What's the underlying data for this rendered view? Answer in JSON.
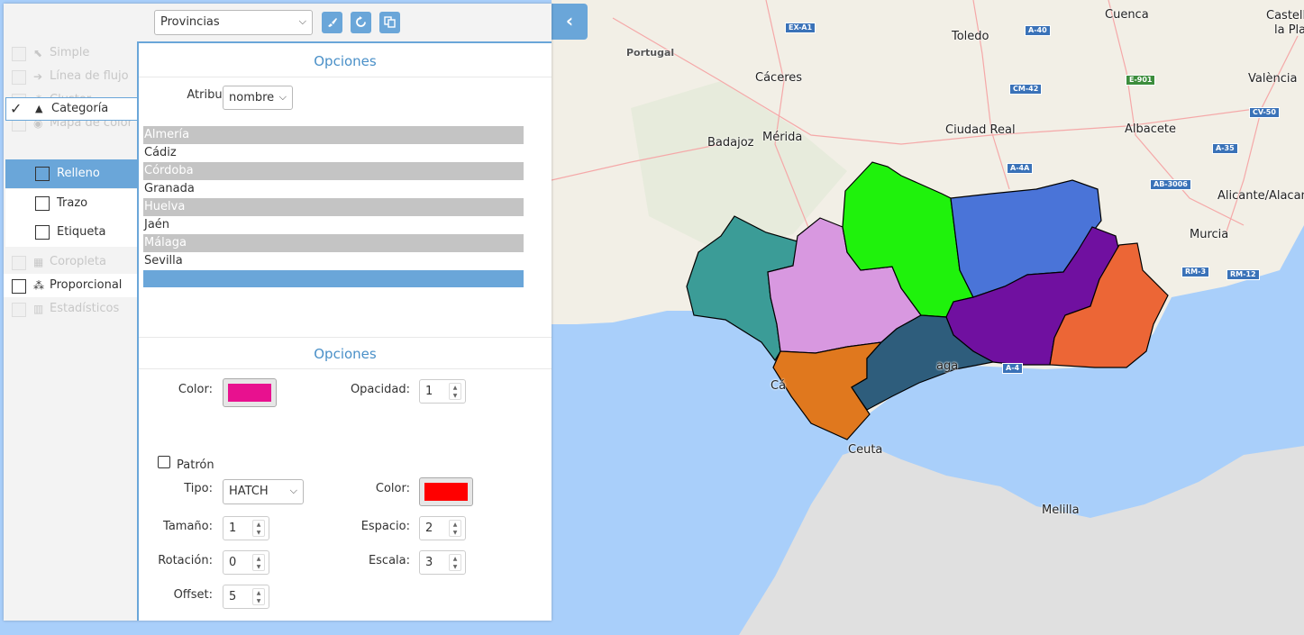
{
  "toolbar": {
    "layer_select": "Provincias",
    "brush_icon": "brush-icon",
    "refresh_icon": "refresh-icon",
    "copy_icon": "copy-icon",
    "collapse_icon": "chevron-left-icon"
  },
  "sidebar": {
    "items": [
      {
        "label": "Simple",
        "icon": "cursor-icon",
        "enabled": false
      },
      {
        "label": "Línea de flujo",
        "icon": "arrow-right-icon",
        "enabled": false
      },
      {
        "label": "Cluster",
        "icon": "cluster-icon",
        "enabled": false
      },
      {
        "label": "Mapa de color",
        "icon": "heatmap-icon",
        "enabled": false
      },
      {
        "label": "Categoría",
        "icon": "category-icon",
        "enabled": true,
        "checked": true
      },
      {
        "label": "Coropleta",
        "icon": "choropleth-icon",
        "enabled": false
      },
      {
        "label": "Proporcional",
        "icon": "proportional-icon",
        "enabled": true
      },
      {
        "label": "Estadísticos",
        "icon": "bar-chart-icon",
        "enabled": false
      }
    ],
    "subitems": [
      {
        "label": "Relleno",
        "active": true
      },
      {
        "label": "Trazo",
        "active": false
      },
      {
        "label": "Etiqueta",
        "active": false
      }
    ]
  },
  "options1": {
    "title": "Opciones",
    "attribute_label": "Atributo:",
    "attribute_value": "nombre",
    "categories": [
      "Almería",
      "Cádiz",
      "Córdoba",
      "Granada",
      "Huelva",
      "Jaén",
      "Málaga",
      "Sevilla",
      ""
    ]
  },
  "options2": {
    "title": "Opciones",
    "color_label": "Color:",
    "color_value": "#e8118f",
    "opacity_label": "Opacidad:",
    "opacity_value": "1",
    "pattern_label": "Patrón",
    "type_label": "Tipo:",
    "type_value": "HATCH",
    "pattern_color_label": "Color:",
    "pattern_color_value": "#ff0000",
    "size_label": "Tamaño:",
    "size_value": "1",
    "space_label": "Espacio:",
    "space_value": "2",
    "rotation_label": "Rotación:",
    "rotation_value": "0",
    "scale_label": "Escala:",
    "scale_value": "3",
    "offset_label": "Offset:",
    "offset_value": "5"
  },
  "map": {
    "cities": [
      "Cuenca",
      "Castell",
      "la Pla",
      "Toledo",
      "Portugal",
      "Cáceres",
      "València",
      "Badajoz",
      "Mérida",
      "Ciudad Real",
      "Albacete",
      "Alicante/Alacan",
      "Murcia",
      "Ceuta",
      "Melilla",
      "Cá",
      "aga"
    ],
    "roads": [
      "EX-A1",
      "A-40",
      "CM-42",
      "E-901",
      "CV-50",
      "A-35",
      "A-4A",
      "AB-3006",
      "RM-3",
      "RM-12",
      "A-4"
    ],
    "province_colors": {
      "huelva": "#3b9c97",
      "sevilla": "#d898e0",
      "cordoba": "#1ff20c",
      "jaen": "#4a74d8",
      "granada": "#7010a0",
      "almeria": "#ec6636",
      "cadiz": "#e0781e",
      "malaga": "#2e5d7c"
    }
  }
}
